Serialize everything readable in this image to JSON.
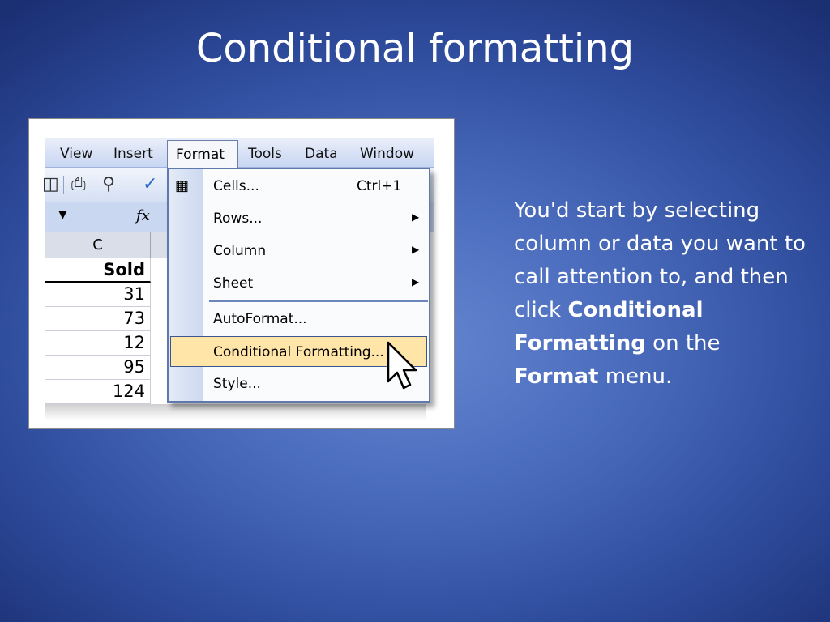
{
  "slide": {
    "title": "Conditional formatting",
    "body": {
      "line1": "You'd start by selecting column  or data you want to call attention to, and then click ",
      "bold1": "Conditional Formatting",
      "line2": " on the ",
      "bold2": "Format",
      "line3": " menu."
    }
  },
  "screenshot": {
    "menubar": [
      "View",
      "Insert",
      "Format",
      "Tools",
      "Data",
      "Window"
    ],
    "formula_fx": "fx",
    "column_header": "C",
    "cells": [
      "Sold",
      "31",
      "73",
      "12",
      "95",
      "124"
    ],
    "menu": {
      "items": [
        {
          "label": "Cells...",
          "shortcut": "Ctrl+1",
          "submenu": false
        },
        {
          "label": "Rows...",
          "shortcut": "",
          "submenu": true
        },
        {
          "label": "Column",
          "shortcut": "",
          "submenu": true
        },
        {
          "label": "Sheet",
          "shortcut": "",
          "submenu": true
        },
        {
          "label": "AutoFormat...",
          "shortcut": "",
          "submenu": false
        },
        {
          "label": "Conditional Formatting...",
          "shortcut": "",
          "submenu": false,
          "highlighted": true
        },
        {
          "label": "Style...",
          "shortcut": "",
          "submenu": false
        }
      ]
    }
  },
  "colors": {
    "highlight": "#ffe6a8",
    "menu_border": "#5f79ad",
    "background": "#4a6bbc"
  }
}
